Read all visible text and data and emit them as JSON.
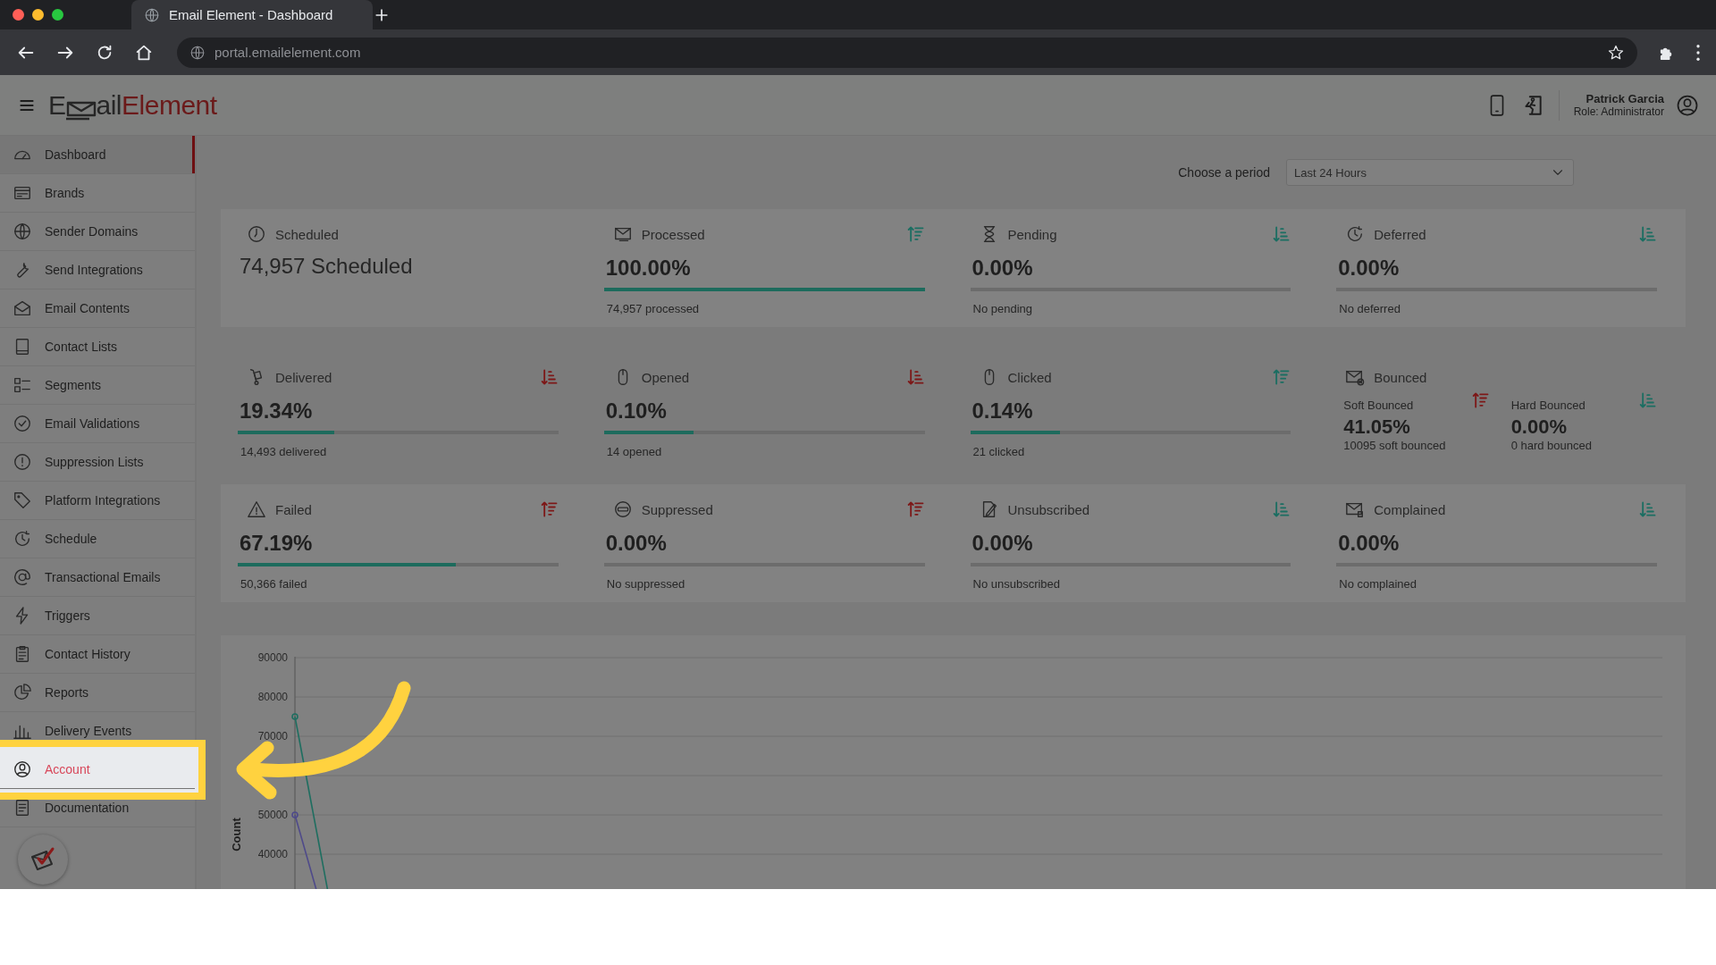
{
  "browser": {
    "tab_title": "Email Element - Dashboard",
    "url": "portal.emailelement.com"
  },
  "header": {
    "logo": {
      "lead": "E",
      "rest": "ail",
      "accent": "Element"
    },
    "user": {
      "name": "Patrick Garcia",
      "role": "Role: Administrator"
    }
  },
  "sidebar": {
    "items": [
      {
        "label": "Dashboard",
        "selected": true,
        "highlighted": false
      },
      {
        "label": "Brands",
        "selected": false,
        "highlighted": false
      },
      {
        "label": "Sender Domains",
        "selected": false,
        "highlighted": false
      },
      {
        "label": "Send Integrations",
        "selected": false,
        "highlighted": false
      },
      {
        "label": "Email Contents",
        "selected": false,
        "highlighted": false
      },
      {
        "label": "Contact Lists",
        "selected": false,
        "highlighted": false
      },
      {
        "label": "Segments",
        "selected": false,
        "highlighted": false
      },
      {
        "label": "Email Validations",
        "selected": false,
        "highlighted": false
      },
      {
        "label": "Suppression Lists",
        "selected": false,
        "highlighted": false
      },
      {
        "label": "Platform Integrations",
        "selected": false,
        "highlighted": false
      },
      {
        "label": "Schedule",
        "selected": false,
        "highlighted": false
      },
      {
        "label": "Transactional Emails",
        "selected": false,
        "highlighted": false
      },
      {
        "label": "Triggers",
        "selected": false,
        "highlighted": false
      },
      {
        "label": "Contact History",
        "selected": false,
        "highlighted": false
      },
      {
        "label": "Reports",
        "selected": false,
        "highlighted": false
      },
      {
        "label": "Delivery Events",
        "selected": false,
        "highlighted": false
      },
      {
        "label": "Account",
        "selected": false,
        "highlighted": true
      },
      {
        "label": "Documentation",
        "selected": false,
        "highlighted": false
      }
    ]
  },
  "period": {
    "label": "Choose a period",
    "value": "Last 24 Hours"
  },
  "stat_rows": [
    {
      "cards": [
        {
          "kind": "count",
          "title": "Scheduled",
          "value": "74,957 Scheduled"
        },
        {
          "kind": "metric",
          "title": "Processed",
          "value": "100.00%",
          "level": 1,
          "detail": "74,957 processed",
          "sort": {
            "trend_up": true,
            "color": "#1b6e62"
          }
        },
        {
          "kind": "metric",
          "title": "Pending",
          "value": "0.00%",
          "level": 0,
          "detail": "No pending",
          "sort": {
            "trend_up": false,
            "color": "#1b6e62"
          }
        },
        {
          "kind": "metric",
          "title": "Deferred",
          "value": "0.00%",
          "level": 0,
          "detail": "No deferred",
          "sort": {
            "trend_up": false,
            "color": "#1b6e62"
          }
        }
      ]
    },
    {
      "cards": [
        {
          "kind": "metric",
          "title": "Delivered",
          "value": "19.34%",
          "level": 0.3,
          "detail": "14,493 delivered",
          "sort": {
            "trend_up": false,
            "color": "#7d1818"
          }
        },
        {
          "kind": "metric",
          "title": "Opened",
          "value": "0.10%",
          "level": 0.28,
          "detail": "14 opened",
          "sort": {
            "trend_up": false,
            "color": "#7d1818"
          }
        },
        {
          "kind": "metric",
          "title": "Clicked",
          "value": "0.14%",
          "level": 0.28,
          "detail": "21 clicked",
          "sort": {
            "trend_up": true,
            "color": "#1b6e62"
          }
        },
        {
          "kind": "split",
          "title": "Bounced",
          "parts": [
            {
              "label": "Soft Bounced",
              "value": "41.05%",
              "detail": "10095 soft bounced",
              "sort": {
                "trend_up": true,
                "color": "#7d1818"
              }
            },
            {
              "label": "Hard Bounced",
              "value": "0.00%",
              "detail": "0 hard bounced",
              "sort": {
                "trend_up": false,
                "color": "#1b6e62"
              }
            }
          ]
        }
      ]
    },
    {
      "cards": [
        {
          "kind": "metric",
          "title": "Failed",
          "value": "67.19%",
          "level": 0.68,
          "detail": "50,366 failed",
          "sort": {
            "trend_up": true,
            "color": "#7d1818"
          }
        },
        {
          "kind": "metric",
          "title": "Suppressed",
          "value": "0.00%",
          "level": 0,
          "detail": "No suppressed",
          "sort": {
            "trend_up": true,
            "color": "#7d1818"
          }
        },
        {
          "kind": "metric",
          "title": "Unsubscribed",
          "value": "0.00%",
          "level": 0,
          "detail": "No unsubscribed",
          "sort": {
            "trend_up": false,
            "color": "#1b6e62"
          }
        },
        {
          "kind": "metric",
          "title": "Complained",
          "value": "0.00%",
          "level": 0,
          "detail": "No complained",
          "sort": {
            "trend_up": false,
            "color": "#1b6e62"
          }
        }
      ]
    }
  ],
  "chart": {
    "y_axis_label": "Count",
    "y_ticks_upper": [
      "90000",
      "80000",
      "70000"
    ],
    "y_ticks_lower": [
      "50000",
      "40000"
    ]
  }
}
